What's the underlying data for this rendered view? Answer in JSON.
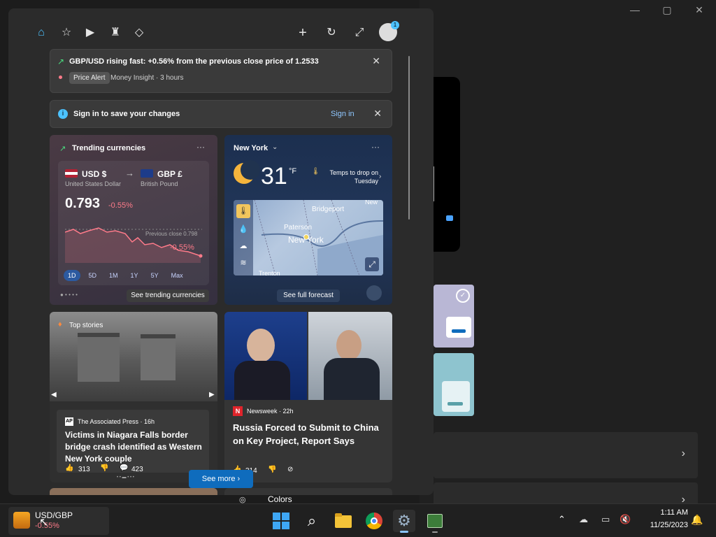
{
  "window_controls": {
    "minimize": "—",
    "maximize": "▢",
    "close": "✕"
  },
  "notification": {
    "headline": "GBP/USD rising fast: +0.56% from the previous close price of 1.2533",
    "tag": "Price Alert",
    "source": "Money Insight · 3 hours"
  },
  "signin_banner": {
    "text": "Sign in to save your changes",
    "link": "Sign in"
  },
  "currency_card": {
    "title": "Trending currencies",
    "from_code": "USD $",
    "from_name": "United States Dollar",
    "to_code": "GBP £",
    "to_name": "British Pound",
    "rate": "0.793",
    "change": "-0.55%",
    "previous_close": "Previous close 0.798",
    "chart_change": "-0.55%",
    "timeframes": [
      "1D",
      "5D",
      "1M",
      "1Y",
      "5Y",
      "Max"
    ],
    "see_more": "See trending currencies"
  },
  "weather_card": {
    "location": "New York",
    "temp": "31",
    "unit": "°F",
    "forecast_note": "Temps to drop on Tuesday",
    "map_labels": [
      "Bridgeport",
      "Paterson",
      "New York",
      "Trenton",
      "New"
    ],
    "see_more": "See full forecast"
  },
  "news": [
    {
      "label": "Top stories",
      "source": "The Associated Press · 16h",
      "headline": "Victims in Niagara Falls border bridge crash identified as Western New York couple",
      "likes": "313",
      "comments": "423"
    },
    {
      "source": "Newsweek · 22h",
      "headline": "Russia Forced to Submit to China on Key Project, Report Says",
      "likes": "314"
    }
  ],
  "see_more_button": "See more",
  "settings_peek": {
    "colors_label": "Colors"
  },
  "taskbar": {
    "widget_title": "USD/GBP",
    "widget_value": "-0.55%",
    "time": "1:11 AM",
    "date": "11/25/2023"
  },
  "colors": {
    "accent": "#0f6cbd",
    "negative": "#ff7b8a",
    "link": "#8fc7ff"
  }
}
